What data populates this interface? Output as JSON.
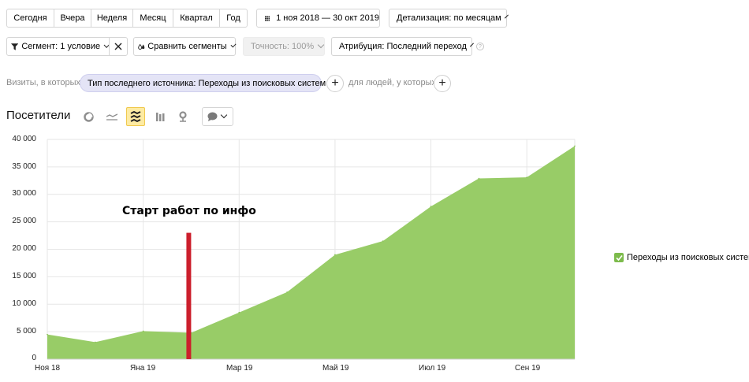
{
  "period_buttons": [
    "Сегодня",
    "Вчера",
    "Неделя",
    "Месяц",
    "Квартал",
    "Год"
  ],
  "date_range": "1 ноя 2018 — 30 окт 2019",
  "detail": "Детализация: по месяцам",
  "segment": "Сегмент: 1 условие",
  "compare": "Сравнить сегменты",
  "accuracy": "Точность: 100%",
  "attribution": "Атрибуция: Последний переход",
  "filter": {
    "prefix": "Визиты, в которых",
    "chip": "Тип последнего источника: Переходы из поисковых систем",
    "people": "для людей, у которых"
  },
  "chart_title": "Посетители",
  "annotation": "Старт работ по инфо",
  "colors": {
    "area": "#98cc67",
    "marker": "#cc1f2c",
    "accent": "#fdeba3"
  },
  "chart_data": {
    "type": "area",
    "x": [
      "Ноя 18",
      "Дек 18",
      "Яна 19",
      "Фев 19",
      "Мар 19",
      "Апр 19",
      "Май 19",
      "Июн 19",
      "Июл 19",
      "Авг 19",
      "Сен 19",
      "Окт 19"
    ],
    "x_tick_labels": [
      "Ноя 18",
      "Яна 19",
      "Мар 19",
      "Май 19",
      "Июл 19",
      "Сен 19"
    ],
    "series": [
      {
        "name": "Переходы из поисковых систем",
        "values": [
          4500,
          3100,
          5100,
          4800,
          8500,
          12200,
          19000,
          21500,
          27800,
          32900,
          33100,
          38800
        ]
      }
    ],
    "y_ticks": [
      "0",
      "5 000",
      "10 000",
      "15 000",
      "20 000",
      "25 000",
      "30 000",
      "35 000",
      "40 000"
    ],
    "ylim": [
      0,
      40000
    ],
    "grid": true,
    "legend": "right",
    "marker": {
      "x": "Фев 19",
      "value": 23000
    }
  }
}
